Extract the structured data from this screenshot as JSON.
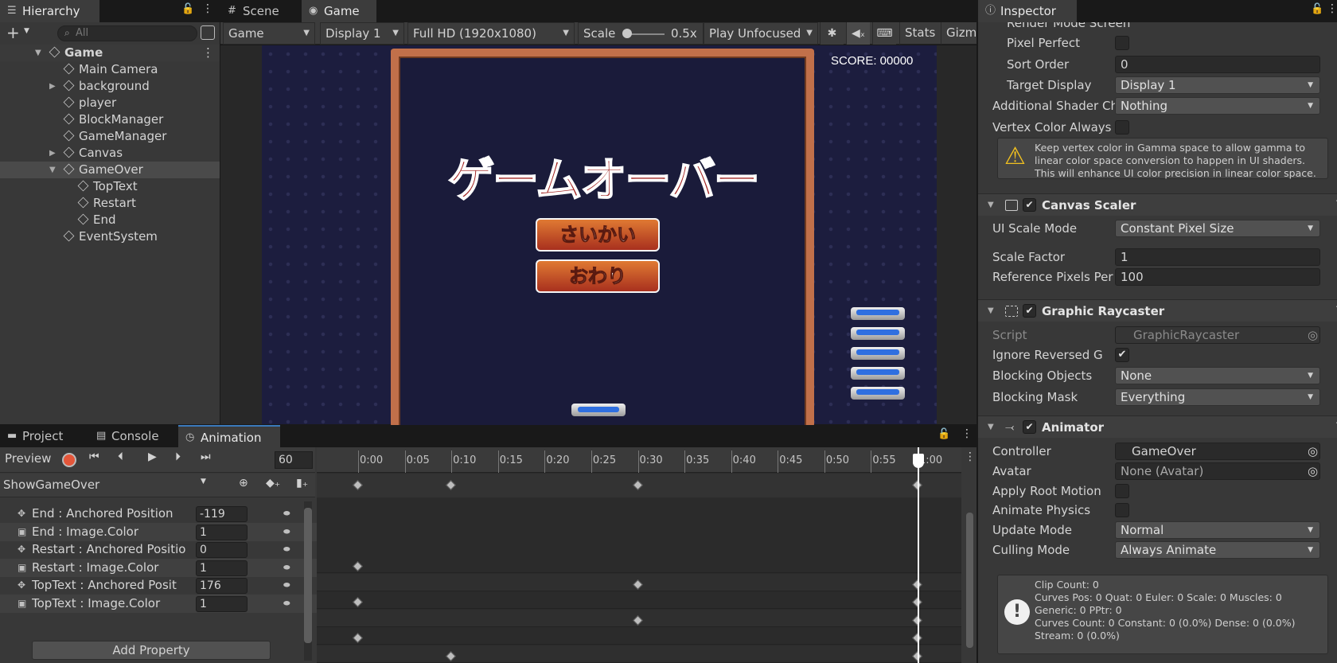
{
  "hierarchy": {
    "tab": "Hierarchy",
    "search_placeholder": "All",
    "root": "Game",
    "items": [
      {
        "label": "Main Camera",
        "expand": ""
      },
      {
        "label": "background",
        "expand": "▶"
      },
      {
        "label": "player",
        "expand": ""
      },
      {
        "label": "BlockManager",
        "expand": ""
      },
      {
        "label": "GameManager",
        "expand": ""
      },
      {
        "label": "Canvas",
        "expand": "▶"
      },
      {
        "label": "GameOver",
        "expand": "▼"
      },
      {
        "label": "TopText",
        "expand": ""
      },
      {
        "label": "Restart",
        "expand": ""
      },
      {
        "label": "End",
        "expand": ""
      },
      {
        "label": "EventSystem",
        "expand": ""
      }
    ]
  },
  "center_tabs": {
    "scene": "Scene",
    "game": "Game"
  },
  "game_toolbar": {
    "mode": "Game",
    "display": "Display 1",
    "resolution": "Full HD (1920x1080)",
    "scale_label": "Scale",
    "scale_value": "0.5x",
    "play_focus": "Play Unfocused",
    "stats": "Stats",
    "gizmos": "Gizm"
  },
  "game_view": {
    "score": "SCORE: 00000",
    "title_text": "ゲームオーバー",
    "restart_button": "さいかい",
    "end_button": "おわり",
    "blocks_right": 5
  },
  "inspector": {
    "tab": "Inspector",
    "partial_top": "Render Mode    Screen Space - Overlay",
    "canvas_rows": [
      {
        "label": "Pixel Perfect",
        "type": "check",
        "value": ""
      },
      {
        "label": "Sort Order",
        "type": "field",
        "value": "0"
      },
      {
        "label": "Target Display",
        "type": "dropdown",
        "value": "Display 1"
      },
      {
        "label": "Additional Shader Ch",
        "type": "dropdown",
        "value": "Nothing"
      },
      {
        "label": "Vertex Color Always I",
        "type": "check",
        "value": ""
      }
    ],
    "help_text": "Keep vertex color in Gamma space to allow gamma to linear color space conversion to happen in UI shaders. This will enhance UI color precision in linear color space.",
    "canvas_scaler": {
      "title": "Canvas Scaler",
      "ui_scale_mode_label": "UI Scale Mode",
      "ui_scale_mode": "Constant Pixel Size",
      "scale_factor_label": "Scale Factor",
      "scale_factor": "1",
      "ref_pixels_label": "Reference Pixels Per",
      "ref_pixels": "100"
    },
    "graphic_raycaster": {
      "title": "Graphic Raycaster",
      "script_label": "Script",
      "script": "GraphicRaycaster",
      "ignore_label": "Ignore Reversed G",
      "ignore": "✔",
      "blocking_objects_label": "Blocking Objects",
      "blocking_objects": "None",
      "blocking_mask_label": "Blocking Mask",
      "blocking_mask": "Everything"
    },
    "animator": {
      "title": "Animator",
      "controller_label": "Controller",
      "controller": "GameOver",
      "avatar_label": "Avatar",
      "avatar": "None (Avatar)",
      "root_motion_label": "Apply Root Motion",
      "physics_label": "Animate Physics",
      "update_label": "Update Mode",
      "update": "Normal",
      "culling_label": "Culling Mode",
      "culling": "Always Animate",
      "info": [
        "Clip Count: 0",
        "Curves Pos: 0 Quat: 0 Euler: 0 Scale: 0 Muscles: 0",
        "Generic: 0 PPtr: 0",
        "Curves Count: 0 Constant: 0 (0.0%) Dense: 0 (0.0%)",
        "Stream: 0 (0.0%)"
      ]
    }
  },
  "bottom_tabs": {
    "project": "Project",
    "console": "Console",
    "animation": "Animation"
  },
  "animation": {
    "preview": "Preview",
    "frame": "60",
    "clip": "ShowGameOver",
    "add_property": "Add Property",
    "ticks": [
      "0:00",
      "0:05",
      "0:10",
      "0:15",
      "0:20",
      "0:25",
      "0:30",
      "0:35",
      "0:40",
      "0:45",
      "0:50",
      "0:55",
      "1:00"
    ],
    "properties": [
      {
        "label": "End : Anchored Position",
        "value": "-119",
        "icon": "✥",
        "keys": [
          0
        ]
      },
      {
        "label": "End : Image.Color",
        "value": "1",
        "icon": "▣",
        "keys": [
          30,
          60
        ]
      },
      {
        "label": "Restart : Anchored Positio",
        "value": "0",
        "icon": "✥",
        "keys": [
          0,
          60
        ]
      },
      {
        "label": "Restart : Image.Color",
        "value": "1",
        "icon": "▣",
        "keys": [
          30,
          60
        ]
      },
      {
        "label": "TopText : Anchored Posit",
        "value": "176",
        "icon": "✥",
        "keys": [
          0,
          60
        ]
      },
      {
        "label": "TopText : Image.Color",
        "value": "1",
        "icon": "▣",
        "keys": [
          10,
          60
        ]
      }
    ],
    "summary_keys": [
      0,
      10,
      30,
      60
    ]
  }
}
